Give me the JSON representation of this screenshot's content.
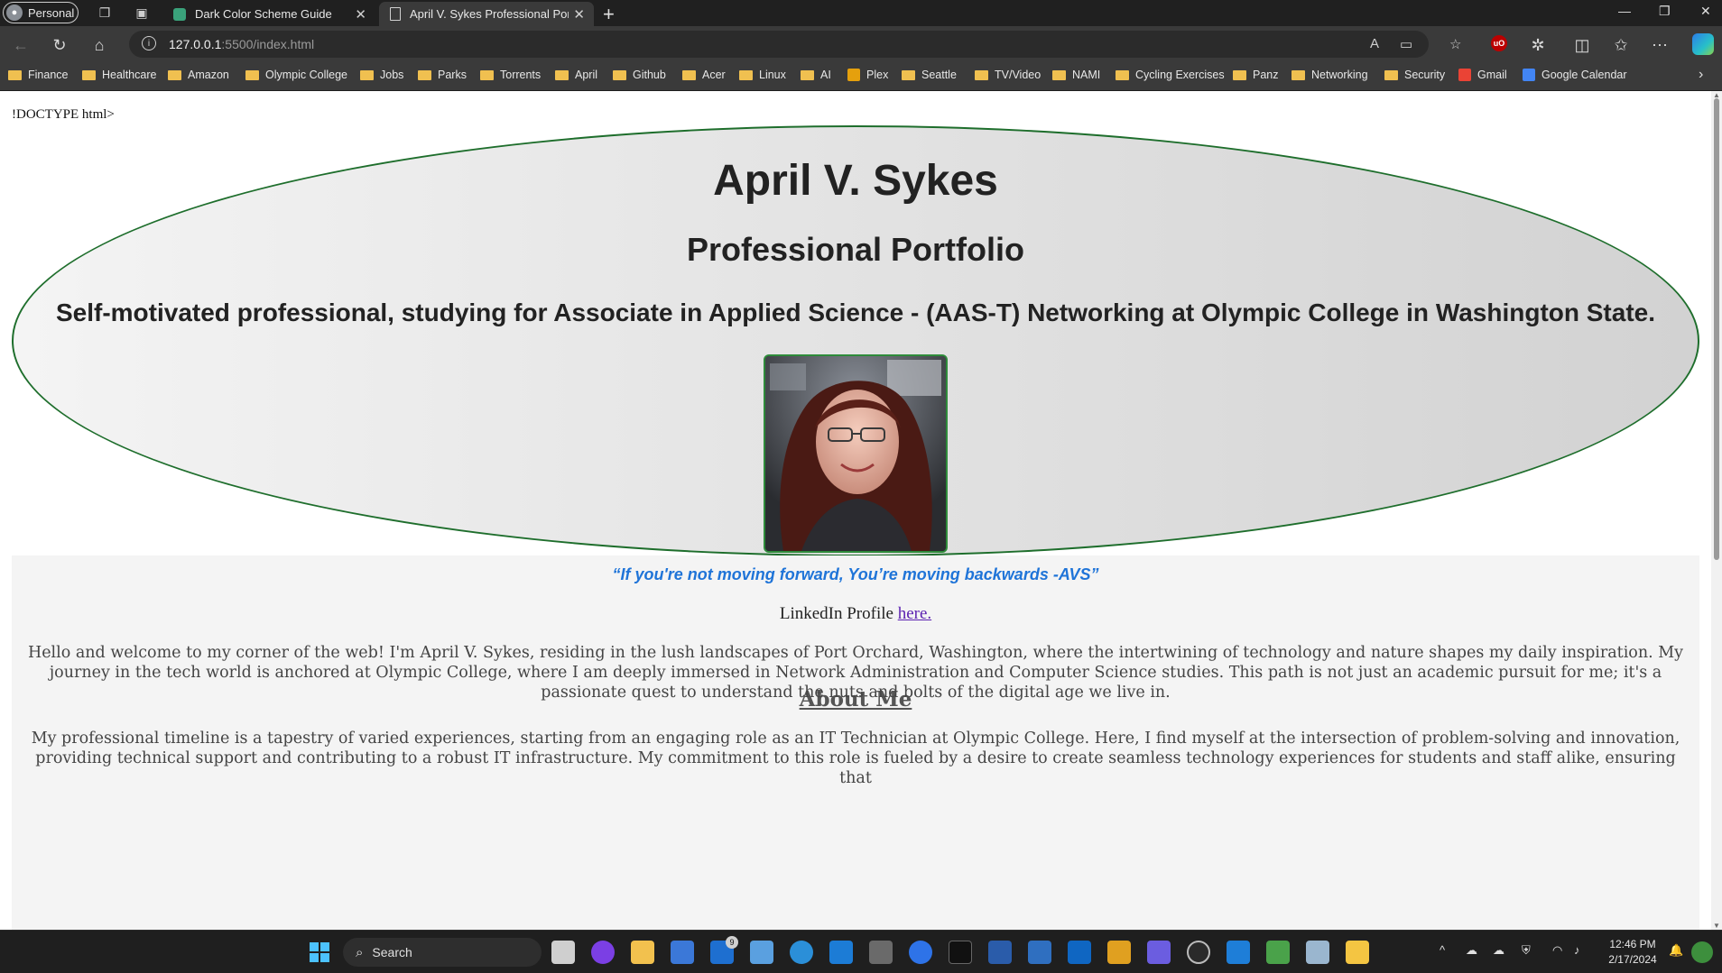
{
  "browser": {
    "profile_label": "Personal",
    "tabs": [
      {
        "title": "Dark Color Scheme Guide",
        "active": false
      },
      {
        "title": "April V. Sykes Professional Portfolio",
        "active": true
      }
    ],
    "url_host": "127.0.0.1",
    "url_rest": ":5500/index.html",
    "bookmarks": [
      "Finance",
      "Healthcare",
      "Amazon",
      "Olympic College",
      "Jobs",
      "Parks",
      "Torrents",
      "April",
      "Github",
      "Acer",
      "Linux",
      "AI",
      "Plex",
      "Seattle",
      "TV/Video",
      "NAMI",
      "Cycling Exercises",
      "Panz",
      "Networking",
      "Security",
      "Gmail",
      "Google Calendar"
    ]
  },
  "page": {
    "doctype_text": "!DOCTYPE html>",
    "name": "April V. Sykes",
    "subtitle": "Professional Portfolio",
    "tagline": "Self-motivated professional, studying for Associate in Applied Science - (AAS-T) Networking at Olympic College in Washington State.",
    "quote": "“If you're not moving forward, You’re moving backwards -AVS”",
    "linkedin_prefix": "LinkedIn Profile ",
    "linkedin_link": "here.",
    "about_title": "About Me",
    "about_p1": "Hello and welcome to my corner of the web! I'm April V. Sykes, residing in the lush landscapes of Port Orchard, Washington, where the intertwining of technology and nature shapes my daily inspiration. My journey in the tech world is anchored at Olympic College, where I am deeply immersed in Network Administration and Computer Science studies. This path is not just an academic pursuit for me; it's a passionate quest to understand the nuts and bolts of the digital age we live in.",
    "about_p2": "My professional timeline is a tapestry of varied experiences, starting from an engaging role as an IT Technician at Olympic College. Here, I find myself at the intersection of problem-solving and innovation, providing technical support and contributing to a robust IT infrastructure. My commitment to this role is fueled by a desire to create seamless technology experiences for students and staff alike, ensuring that"
  },
  "taskbar": {
    "search_label": "Search",
    "mail_badge": "9",
    "time": "12:46 PM",
    "date": "2/17/2024"
  },
  "colors": {
    "header_border": "#1e6e2c",
    "quote": "#1f74d8",
    "link": "#5a1fb0"
  }
}
